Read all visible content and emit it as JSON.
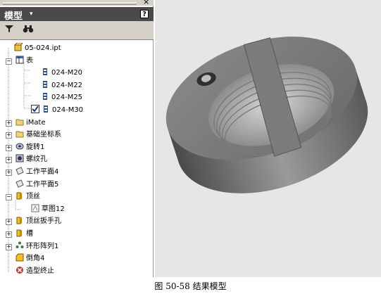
{
  "panel": {
    "close_glyph": "×",
    "title": "模型",
    "dropdown_glyph": "▾",
    "help_glyph": "?",
    "toolbar": {
      "filter_icon": "filter-icon",
      "find_icon": "binoculars-icon"
    }
  },
  "tree": [
    {
      "label": "05-024.ipt",
      "icon": "part-icon"
    },
    {
      "label": "表",
      "icon": "table-icon"
    },
    {
      "label": "024-M20",
      "icon": "row-icon"
    },
    {
      "label": "024-M22",
      "icon": "row-icon"
    },
    {
      "label": "024-M25",
      "icon": "row-icon"
    },
    {
      "label": "024-M30",
      "icon": "row-icon",
      "checked": true
    },
    {
      "label": "iMate",
      "icon": "folder-icon"
    },
    {
      "label": "基础坐标系",
      "icon": "folder-icon"
    },
    {
      "label": "旋转1",
      "icon": "revolve-icon"
    },
    {
      "label": "螺纹孔",
      "icon": "hole-icon"
    },
    {
      "label": "工作平面4",
      "icon": "workplane-icon"
    },
    {
      "label": "工作平面5",
      "icon": "workplane-icon"
    },
    {
      "label": "顶丝",
      "icon": "extrude-icon"
    },
    {
      "label": "草图12",
      "icon": "sketch-icon"
    },
    {
      "label": "顶丝扳手孔",
      "icon": "extrude-icon"
    },
    {
      "label": "槽",
      "icon": "extrude-icon"
    },
    {
      "label": "环形阵列1",
      "icon": "pattern-icon"
    },
    {
      "label": "倒角4",
      "icon": "chamfer-icon"
    },
    {
      "label": "造型终止",
      "icon": "end-of-part-icon"
    }
  ],
  "caption": "图 50-58  结果模型"
}
